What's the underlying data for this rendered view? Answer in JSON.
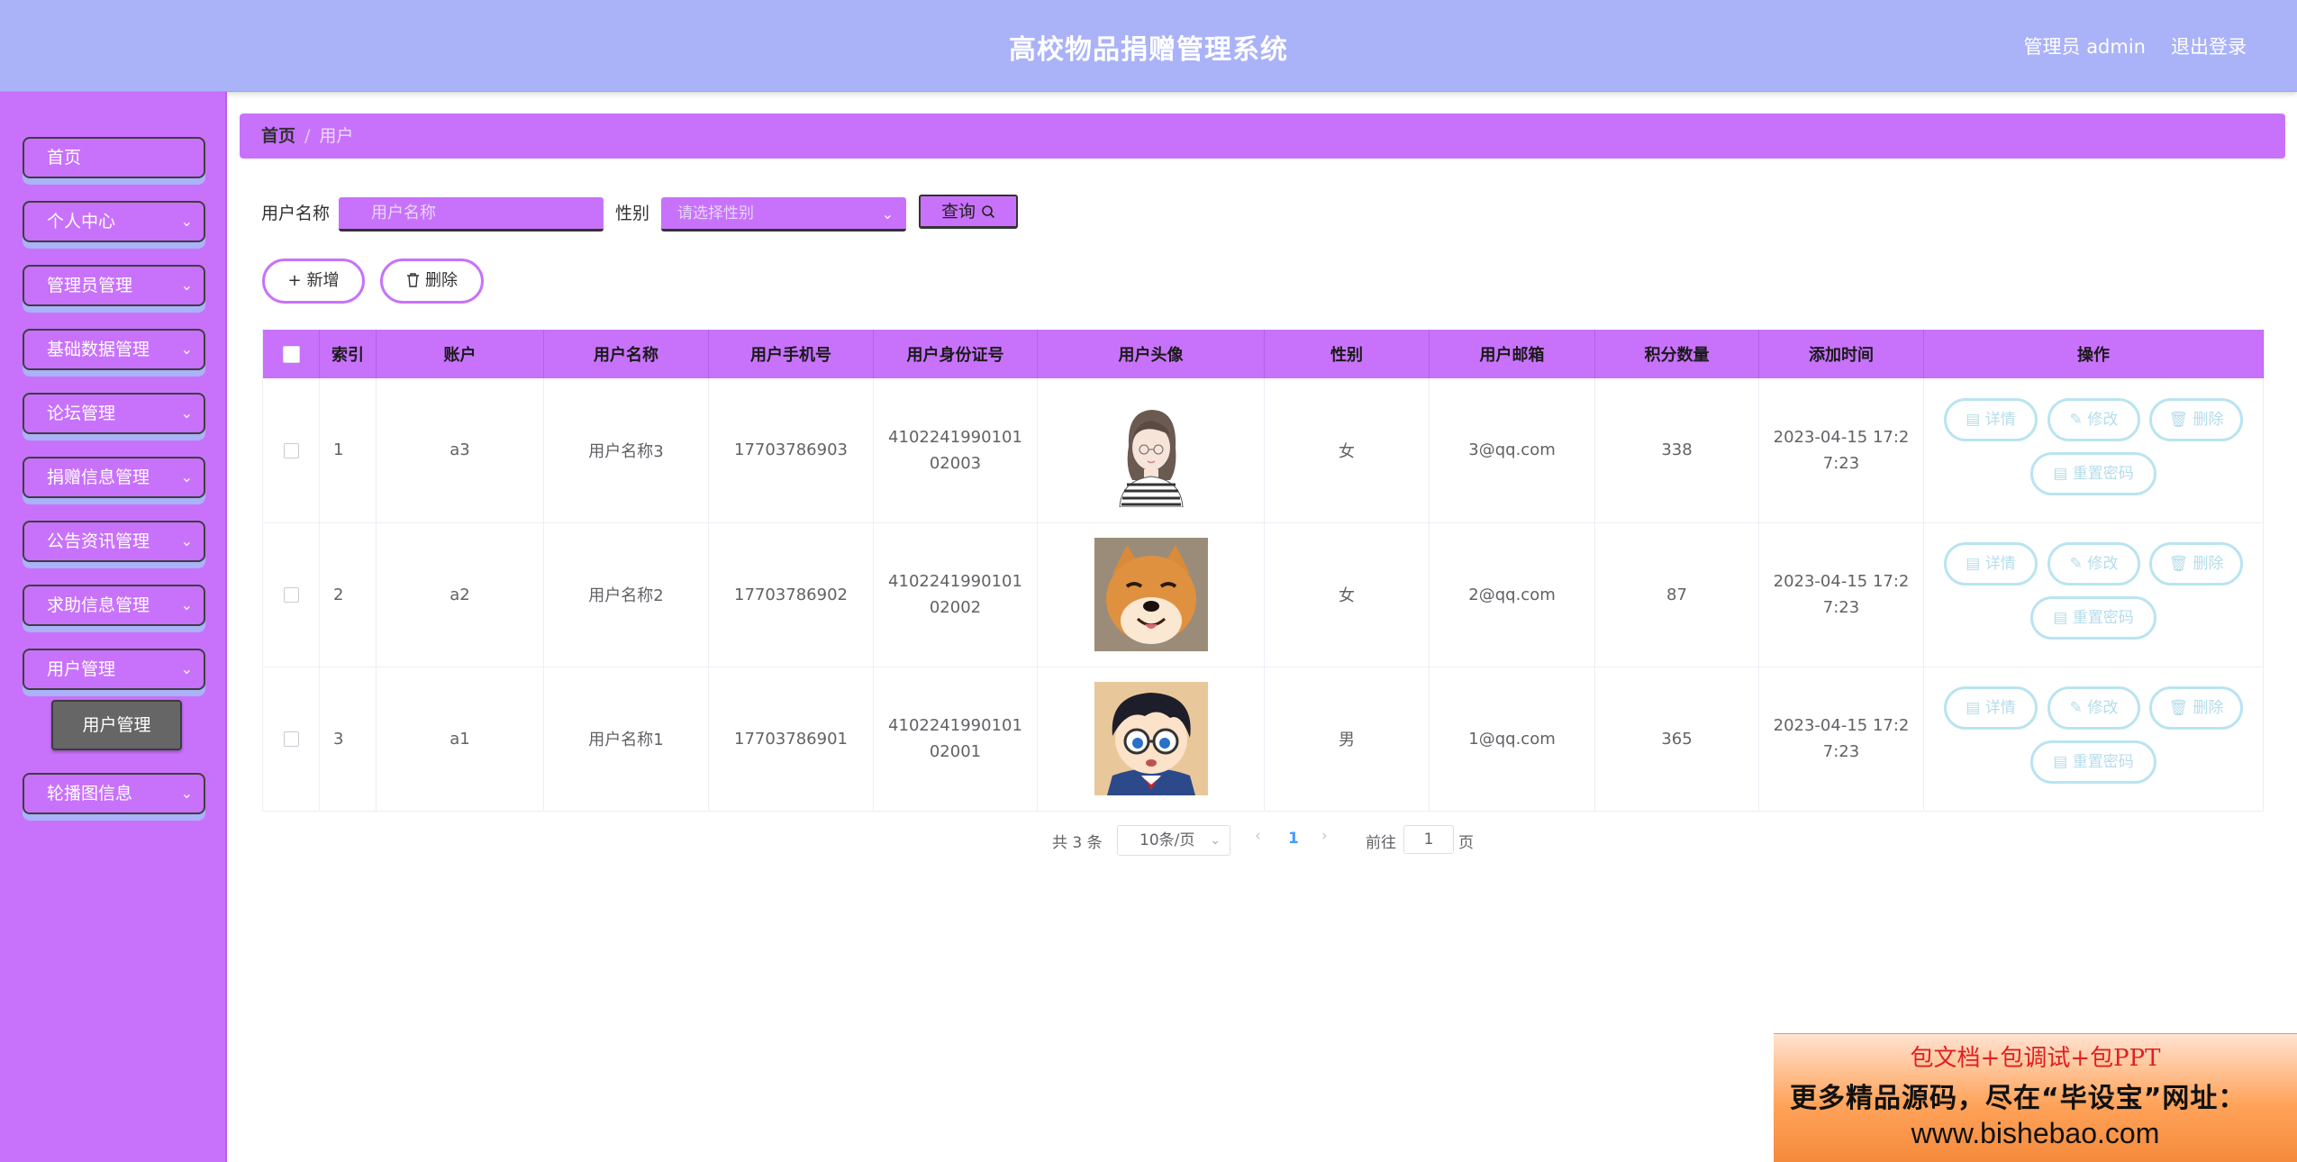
{
  "header": {
    "title": "高校物品捐赠管理系统",
    "user": "管理员 admin",
    "logout": "退出登录"
  },
  "sidebar": {
    "items": [
      {
        "label": "首页"
      },
      {
        "label": "个人中心"
      },
      {
        "label": "管理员管理"
      },
      {
        "label": "基础数据管理"
      },
      {
        "label": "论坛管理"
      },
      {
        "label": "捐赠信息管理"
      },
      {
        "label": "公告资讯管理"
      },
      {
        "label": "求助信息管理"
      },
      {
        "label": "用户管理"
      },
      {
        "label": "轮播图信息"
      }
    ],
    "submenu": {
      "label": "用户管理"
    }
  },
  "breadcrumb": {
    "home": "首页",
    "sep": "/",
    "current": "用户"
  },
  "search": {
    "name_label": "用户名称",
    "name_placeholder": "用户名称",
    "gender_label": "性别",
    "gender_placeholder": "请选择性别",
    "query_label": "查询"
  },
  "actions": {
    "add": "新增",
    "delete": "删除"
  },
  "table": {
    "headers": [
      "索引",
      "账户",
      "用户名称",
      "用户手机号",
      "用户身份证号",
      "用户头像",
      "性别",
      "用户邮箱",
      "积分数量",
      "添加时间",
      "操作"
    ],
    "rows": [
      {
        "index": "1",
        "account": "a3",
        "name": "用户名称3",
        "phone": "17703786903",
        "idcard": "410224199010102003",
        "avatar": "girl-sketch-avatar",
        "gender": "女",
        "email": "3@qq.com",
        "points": "338",
        "time": "2023-04-15 17:27:23"
      },
      {
        "index": "2",
        "account": "a2",
        "name": "用户名称2",
        "phone": "17703786902",
        "idcard": "410224199010102002",
        "avatar": "shiba-dog-avatar",
        "gender": "女",
        "email": "2@qq.com",
        "points": "87",
        "time": "2023-04-15 17:27:23"
      },
      {
        "index": "3",
        "account": "a1",
        "name": "用户名称1",
        "phone": "17703786901",
        "idcard": "410224199010102001",
        "avatar": "cartoon-boy-avatar",
        "gender": "男",
        "email": "1@qq.com",
        "points": "365",
        "time": "2023-04-15 17:27:23"
      }
    ],
    "ops": {
      "detail": "详情",
      "edit": "修改",
      "delete": "删除",
      "reset": "重置密码"
    }
  },
  "pagination": {
    "total": "共 3 条",
    "page_size": "10条/页",
    "current": "1",
    "goto_label": "前往",
    "goto_value": "1",
    "page_unit": "页"
  },
  "watermark": {
    "line1": "包文档+包调试+包PPT",
    "line2": "更多精品源码，尽在“毕设宝”网址：",
    "line3": "www.bishebao.com"
  },
  "colors": {
    "header": "#aab2f8",
    "sidebar": "#c872fb",
    "accent": "#c872fb",
    "op_border": "#b9e4f0",
    "page_active": "#409eff"
  }
}
